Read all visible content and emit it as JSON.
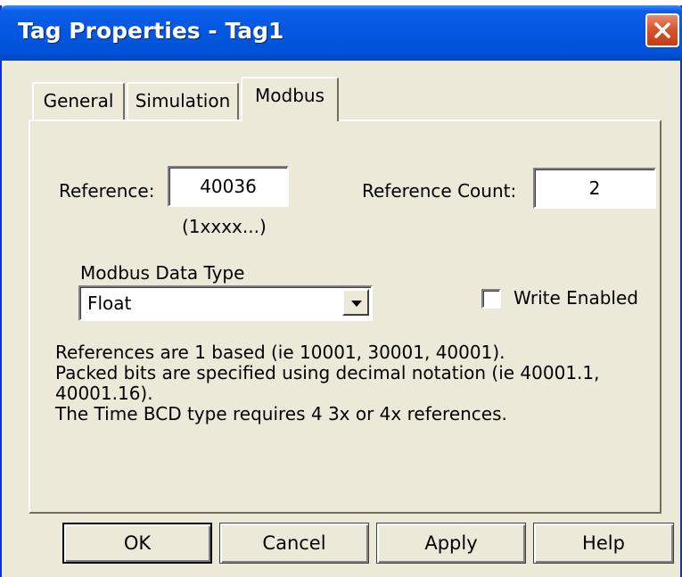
{
  "window": {
    "title": "Tag Properties - Tag1"
  },
  "tabs": [
    {
      "label": "General",
      "active": false
    },
    {
      "label": "Simulation",
      "active": false
    },
    {
      "label": "Modbus",
      "active": true
    }
  ],
  "modbus": {
    "reference_label": "Reference:",
    "reference_value": "40036",
    "reference_hint": "(1xxxx...)",
    "reference_count_label": "Reference Count:",
    "reference_count_value": "2",
    "data_type_label": "Modbus Data Type",
    "data_type_selected": "Float",
    "write_enabled_label": "Write Enabled",
    "write_enabled_checked": false,
    "notes": [
      "References are 1 based (ie 10001, 30001, 40001).",
      "Packed bits are specified using decimal notation (ie 40001.1, 40001.16).",
      "The Time BCD type requires 4 3x or 4x references."
    ]
  },
  "buttons": {
    "ok": "OK",
    "cancel": "Cancel",
    "apply": "Apply",
    "help": "Help"
  },
  "colors": {
    "titlebar": "#0458e0",
    "window_bg": "#ece9d8",
    "close_button": "#d8552f"
  },
  "icons": {
    "close": "close-icon",
    "dropdown": "chevron-down-icon"
  }
}
